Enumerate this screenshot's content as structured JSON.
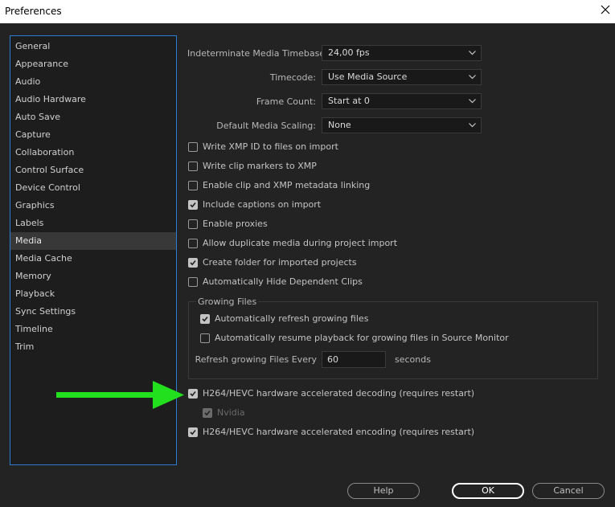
{
  "window": {
    "title": "Preferences"
  },
  "sidebar": {
    "items": [
      {
        "label": "General"
      },
      {
        "label": "Appearance"
      },
      {
        "label": "Audio"
      },
      {
        "label": "Audio Hardware"
      },
      {
        "label": "Auto Save"
      },
      {
        "label": "Capture"
      },
      {
        "label": "Collaboration"
      },
      {
        "label": "Control Surface"
      },
      {
        "label": "Device Control"
      },
      {
        "label": "Graphics"
      },
      {
        "label": "Labels"
      },
      {
        "label": "Media"
      },
      {
        "label": "Media Cache"
      },
      {
        "label": "Memory"
      },
      {
        "label": "Playback"
      },
      {
        "label": "Sync Settings"
      },
      {
        "label": "Timeline"
      },
      {
        "label": "Trim"
      }
    ],
    "selected": "Media"
  },
  "fields": {
    "timebase": {
      "label": "Indeterminate Media Timebase:",
      "value": "24,00 fps"
    },
    "timecode": {
      "label": "Timecode:",
      "value": "Use Media Source"
    },
    "frame_count": {
      "label": "Frame Count:",
      "value": "Start at 0"
    },
    "scaling": {
      "label": "Default Media Scaling:",
      "value": "None"
    }
  },
  "checks": {
    "xmp_id": {
      "label": "Write XMP ID to files on import",
      "checked": false
    },
    "clip_markers": {
      "label": "Write clip markers to XMP",
      "checked": false
    },
    "xmp_linking": {
      "label": "Enable clip and XMP metadata linking",
      "checked": false
    },
    "captions": {
      "label": "Include captions on import",
      "checked": true
    },
    "proxies": {
      "label": "Enable proxies",
      "checked": false
    },
    "duplicate": {
      "label": "Allow duplicate media during project import",
      "checked": false
    },
    "create_folder": {
      "label": "Create folder for imported projects",
      "checked": true
    },
    "hide_dependent": {
      "label": "Automatically Hide Dependent Clips",
      "checked": false
    }
  },
  "growing": {
    "title": "Growing Files",
    "auto_refresh": {
      "label": "Automatically refresh growing files",
      "checked": true
    },
    "auto_resume": {
      "label": "Automatically resume playback for growing files in Source Monitor",
      "checked": false
    },
    "refresh_label": "Refresh growing Files Every",
    "refresh_value": "60",
    "refresh_unit": "seconds"
  },
  "hardware": {
    "decoding": {
      "label": "H264/HEVC hardware accelerated decoding (requires restart)",
      "checked": true
    },
    "nvidia": {
      "label": "Nvidia",
      "checked": true,
      "disabled": true
    },
    "encoding": {
      "label": "H264/HEVC hardware accelerated encoding (requires restart)",
      "checked": true
    }
  },
  "buttons": {
    "help": "Help",
    "ok": "OK",
    "cancel": "Cancel"
  },
  "colors": {
    "accent_arrow": "#22e01e",
    "selection_border": "#2d7bd5"
  }
}
